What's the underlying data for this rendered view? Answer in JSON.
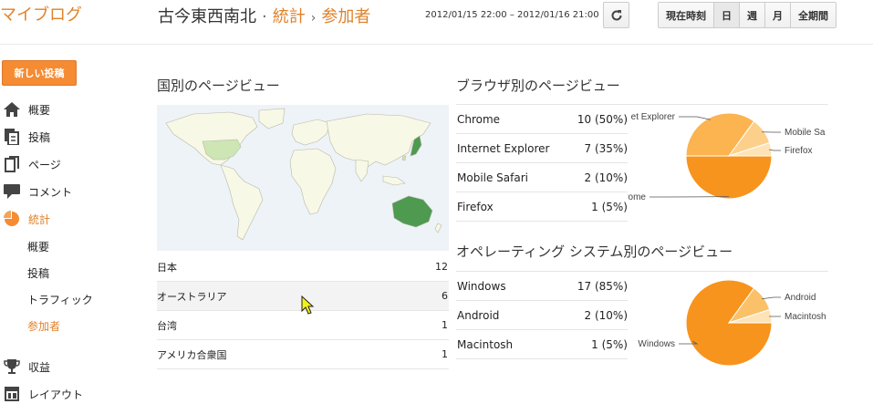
{
  "header": {
    "brand": "マイブログ",
    "blog_name": "古今東西南北",
    "separator": "·",
    "crumb_stats": "統計",
    "arrow": "›",
    "crumb_audience": "参加者",
    "date_range": "2012/01/15 22:00 – 2012/01/16 21:00",
    "ranges": [
      "現在時刻",
      "日",
      "週",
      "月",
      "全期間"
    ],
    "active_range": "日"
  },
  "sidebar": {
    "new_post": "新しい投稿",
    "items": [
      {
        "label": "概要",
        "icon": "home-icon"
      },
      {
        "label": "投稿",
        "icon": "posts-icon"
      },
      {
        "label": "ページ",
        "icon": "page-icon"
      },
      {
        "label": "コメント",
        "icon": "comment-icon"
      },
      {
        "label": "統計",
        "icon": "stats-pie-icon"
      },
      {
        "label": "収益",
        "icon": "trophy-icon"
      },
      {
        "label": "レイアウト",
        "icon": "layout-icon"
      }
    ],
    "sub_items": [
      "概要",
      "投稿",
      "トラフィック",
      "参加者"
    ]
  },
  "country": {
    "heading": "国別のページビュー",
    "rows": [
      {
        "name": "日本",
        "count": "12"
      },
      {
        "name": "オーストラリア",
        "count": "6"
      },
      {
        "name": "台湾",
        "count": "1"
      },
      {
        "name": "アメリカ合衆国",
        "count": "1"
      }
    ]
  },
  "browser": {
    "heading": "ブラウザ別のページビュー",
    "rows": [
      {
        "name": "Chrome",
        "value": "10 (50%)"
      },
      {
        "name": "Internet Explorer",
        "value": "7 (35%)"
      },
      {
        "name": "Mobile Safari",
        "value": "2 (10%)"
      },
      {
        "name": "Firefox",
        "value": "1 (5%)"
      }
    ]
  },
  "os": {
    "heading": "オペレーティング システム別のページビュー",
    "rows": [
      {
        "name": "Windows",
        "value": "17 (85%)"
      },
      {
        "name": "Android",
        "value": "2 (10%)"
      },
      {
        "name": "Macintosh",
        "value": "1 (5%)"
      }
    ]
  },
  "chart_data": [
    {
      "type": "pie",
      "categories": [
        "Chrome",
        "Internet Explorer",
        "Mobile Safari",
        "Firefox"
      ],
      "values": [
        50,
        35,
        10,
        5
      ],
      "labels": [
        "Chrome",
        "et Explorer",
        "Mobile Sa",
        "Firefox"
      ],
      "colors": [
        "#f7941d",
        "#fbb450",
        "#fcd08a",
        "#fde3b5"
      ]
    },
    {
      "type": "pie",
      "categories": [
        "Windows",
        "Android",
        "Macintosh"
      ],
      "values": [
        85,
        10,
        5
      ],
      "labels": [
        "Windows",
        "Android",
        "Macintosh"
      ],
      "colors": [
        "#f7941d",
        "#fbc168",
        "#fde3b5"
      ]
    }
  ],
  "colors": {
    "accent": "#e0822b",
    "button": "#f58b32",
    "land": "#f7f8e6",
    "highlight_us": "#cde6b4",
    "highlight_au": "#4d9a50"
  }
}
